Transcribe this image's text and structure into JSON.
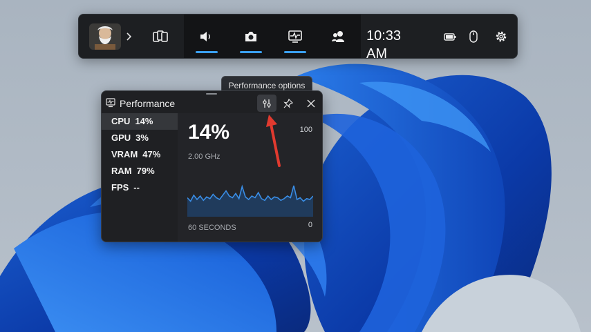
{
  "gamebar": {
    "time": "10:33 AM",
    "widgets": [
      "widget-menu",
      "audio",
      "capture",
      "performance",
      "social"
    ],
    "accent": "#3aa0f0"
  },
  "tooltip": {
    "text": "Performance options"
  },
  "performance": {
    "title": "Performance",
    "metrics": [
      {
        "label": "CPU",
        "value": "14%",
        "selected": true
      },
      {
        "label": "GPU",
        "value": "3%",
        "selected": false
      },
      {
        "label": "VRAM",
        "value": "47%",
        "selected": false
      },
      {
        "label": "RAM",
        "value": "79%",
        "selected": false
      },
      {
        "label": "FPS",
        "value": "--",
        "selected": false
      }
    ],
    "detail": {
      "value": "14%",
      "frequency": "2.00 GHz",
      "axis_max": "100",
      "axis_min": "0",
      "window_label": "60 SECONDS"
    },
    "graph_values": [
      22,
      18,
      25,
      20,
      24,
      19,
      23,
      21,
      26,
      22,
      20,
      25,
      30,
      24,
      22,
      27,
      21,
      35,
      23,
      20,
      24,
      22,
      28,
      21,
      19,
      24,
      20,
      23,
      22,
      19,
      21,
      24,
      22,
      36,
      20,
      22,
      18,
      21,
      20,
      24
    ],
    "graph_color": "#3a8ee6"
  }
}
